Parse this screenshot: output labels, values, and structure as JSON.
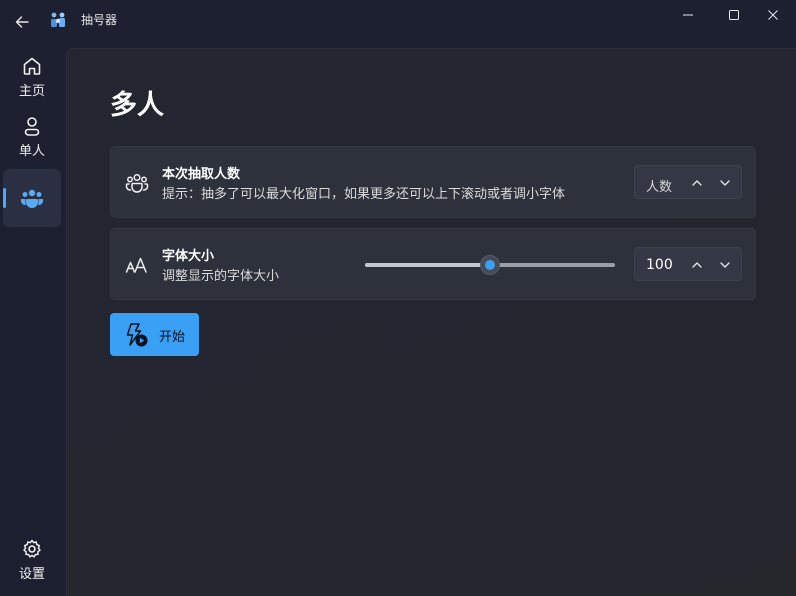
{
  "window": {
    "title": "抽号器",
    "icons": {
      "back": "arrow-left",
      "app": "app-logo",
      "minimize": "minimize",
      "maximize": "maximize",
      "close": "close"
    }
  },
  "sidebar": {
    "items": [
      {
        "label": "主页",
        "icon": "home-icon"
      },
      {
        "label": "单人",
        "icon": "person-icon"
      },
      {
        "label": "",
        "icon": "people-group-icon",
        "selected": true
      },
      {
        "label": "设置",
        "icon": "gear-icon"
      }
    ],
    "accent": "#4aa8ff"
  },
  "main": {
    "title": "多人",
    "count_card": {
      "title": "本次抽取人数",
      "subtitle": "提示：抽多了可以最大化窗口，如果更多还可以上下滚动或者调小字体",
      "input_placeholder": "人数",
      "input_value": ""
    },
    "font_card": {
      "title": "字体大小",
      "subtitle": "调整显示的字体大小",
      "slider_fraction": 0.5,
      "input_value": "100"
    },
    "start_button": {
      "label": "开始",
      "color": "#3aa0f5"
    }
  }
}
